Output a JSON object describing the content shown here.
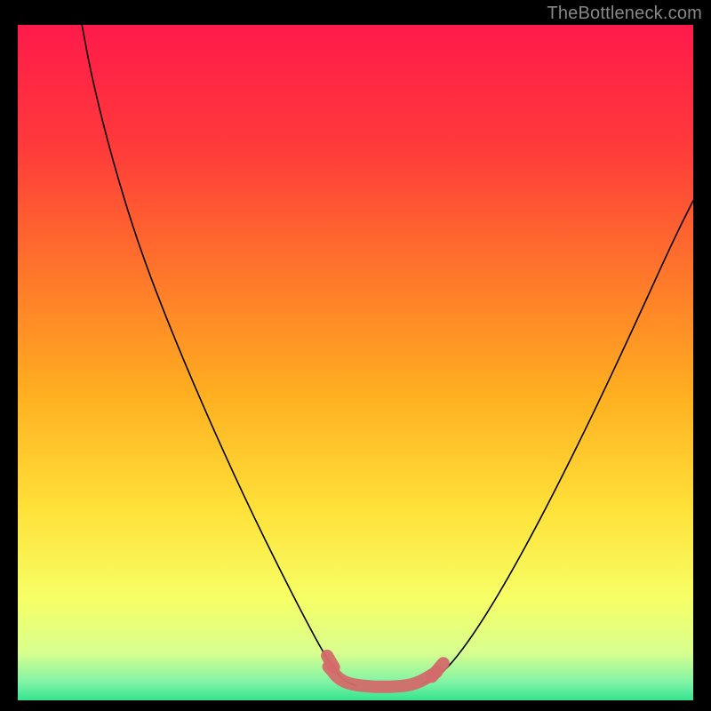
{
  "watermark": "TheBottleneck.com",
  "chart_data": {
    "type": "line",
    "title": "",
    "xlabel": "",
    "ylabel": "",
    "xlim": [
      0,
      100
    ],
    "ylim": [
      0,
      100
    ],
    "gradient_stops": [
      {
        "offset": 0.0,
        "color": "#ff1a4b"
      },
      {
        "offset": 0.18,
        "color": "#ff3a3a"
      },
      {
        "offset": 0.38,
        "color": "#ff7a2a"
      },
      {
        "offset": 0.55,
        "color": "#ffb020"
      },
      {
        "offset": 0.72,
        "color": "#ffe23a"
      },
      {
        "offset": 0.85,
        "color": "#f6ff66"
      },
      {
        "offset": 0.93,
        "color": "#d8ff8f"
      },
      {
        "offset": 0.975,
        "color": "#7cf3a6"
      },
      {
        "offset": 1.0,
        "color": "#35e38e"
      }
    ],
    "series": [
      {
        "name": "left-arm",
        "stroke": "#000000",
        "stroke_width": 1.6,
        "points": [
          {
            "x": 9.5,
            "y": 100.0
          },
          {
            "x": 11.0,
            "y": 92.0
          },
          {
            "x": 14.0,
            "y": 80.0
          },
          {
            "x": 18.0,
            "y": 67.0
          },
          {
            "x": 23.0,
            "y": 54.0
          },
          {
            "x": 29.0,
            "y": 40.0
          },
          {
            "x": 35.0,
            "y": 27.0
          },
          {
            "x": 41.0,
            "y": 15.0
          },
          {
            "x": 45.5,
            "y": 6.5
          },
          {
            "x": 48.0,
            "y": 3.0
          },
          {
            "x": 50.0,
            "y": 2.2
          }
        ]
      },
      {
        "name": "right-arm",
        "stroke": "#000000",
        "stroke_width": 1.6,
        "points": [
          {
            "x": 60.0,
            "y": 2.5
          },
          {
            "x": 63.0,
            "y": 4.0
          },
          {
            "x": 67.0,
            "y": 9.0
          },
          {
            "x": 72.0,
            "y": 17.0
          },
          {
            "x": 78.0,
            "y": 28.0
          },
          {
            "x": 85.0,
            "y": 42.0
          },
          {
            "x": 92.0,
            "y": 57.0
          },
          {
            "x": 97.0,
            "y": 68.0
          },
          {
            "x": 100.0,
            "y": 74.0
          }
        ]
      },
      {
        "name": "bottom-highlight",
        "stroke": "#d36a6a",
        "stroke_width": 14,
        "linecap": "round",
        "points": [
          {
            "x": 46.0,
            "y": 5.0
          },
          {
            "x": 48.0,
            "y": 2.6
          },
          {
            "x": 52.0,
            "y": 2.0
          },
          {
            "x": 56.0,
            "y": 2.0
          },
          {
            "x": 59.0,
            "y": 2.4
          },
          {
            "x": 62.0,
            "y": 4.2
          }
        ]
      },
      {
        "name": "left-dot",
        "stroke": "#d36a6a",
        "stroke_width": 14,
        "linecap": "round",
        "points": [
          {
            "x": 45.8,
            "y": 6.6
          },
          {
            "x": 46.8,
            "y": 4.9
          }
        ]
      },
      {
        "name": "right-dot",
        "stroke": "#d36a6a",
        "stroke_width": 14,
        "linecap": "round",
        "points": [
          {
            "x": 61.3,
            "y": 3.5
          },
          {
            "x": 63.0,
            "y": 5.5
          }
        ]
      }
    ]
  }
}
